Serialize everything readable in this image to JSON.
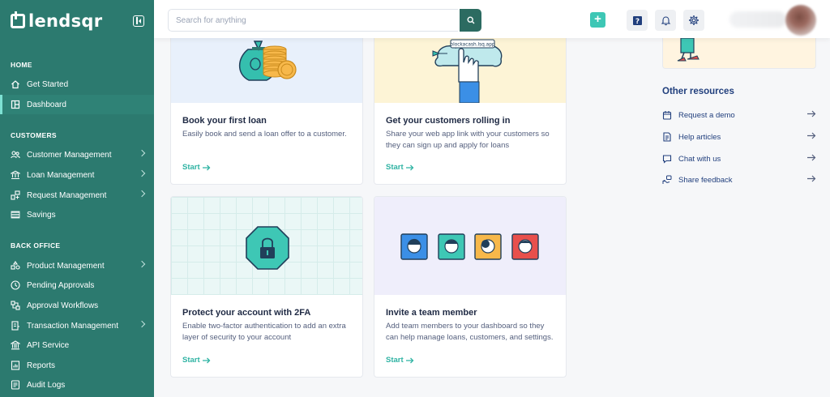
{
  "brand": {
    "name": "lendsqr"
  },
  "sidebar": {
    "sections": [
      {
        "label": "HOME"
      },
      {
        "label": "CUSTOMERS"
      },
      {
        "label": "BACK OFFICE"
      }
    ],
    "items": [
      {
        "label": "Get Started",
        "icon": "home-icon"
      },
      {
        "label": "Dashboard",
        "icon": "dashboard-icon",
        "active": true
      },
      {
        "label": "Customer Management",
        "icon": "users-icon",
        "has_children": true
      },
      {
        "label": "Loan Management",
        "icon": "bank-icon",
        "has_children": true
      },
      {
        "label": "Request Management",
        "icon": "request-icon",
        "has_children": true
      },
      {
        "label": "Savings",
        "icon": "piggy-bank-icon"
      },
      {
        "label": "Product Management",
        "icon": "product-icon",
        "has_children": true
      },
      {
        "label": "Pending Approvals",
        "icon": "clock-icon"
      },
      {
        "label": "Approval Workflows",
        "icon": "workflow-icon"
      },
      {
        "label": "Transaction Management",
        "icon": "transaction-icon",
        "has_children": true
      },
      {
        "label": "API Service",
        "icon": "api-icon"
      },
      {
        "label": "Reports",
        "icon": "reports-icon"
      },
      {
        "label": "Audit Logs",
        "icon": "audit-icon"
      }
    ]
  },
  "header": {
    "search_placeholder": "Search for anything",
    "add_label": "+"
  },
  "cards": [
    {
      "title": "Book your first loan",
      "description": "Easily book and send a loan offer to a customer.",
      "link": "Start",
      "illustration": "money-bag-coins"
    },
    {
      "title": "Get your customers rolling in",
      "description": "Share your web app link with your customers so they can sign up and apply for loans",
      "link": "Start",
      "illustration": "cloud-link",
      "illustration_text": "blockacash.lsq.app"
    },
    {
      "title": "Protect your account with 2FA",
      "description": "Enable two-factor authentication to add an extra layer of security to your account",
      "link": "Start",
      "illustration": "lock-octagon"
    },
    {
      "title": "Invite a team member",
      "description": "Add team members to your dashboard so they can help manage loans, customers, and settings.",
      "link": "Start",
      "illustration": "team-avatars"
    }
  ],
  "resources": {
    "title": "Other resources",
    "items": [
      {
        "label": "Request a demo",
        "icon": "calendar-icon"
      },
      {
        "label": "Help articles",
        "icon": "document-icon"
      },
      {
        "label": "Chat with us",
        "icon": "chat-icon"
      },
      {
        "label": "Share feedback",
        "icon": "feedback-icon"
      }
    ]
  },
  "colors": {
    "sidebar": "#2c7a6f",
    "accent": "#3ec7b5",
    "link": "#2fb3a3",
    "text_primary": "#213f7d"
  }
}
